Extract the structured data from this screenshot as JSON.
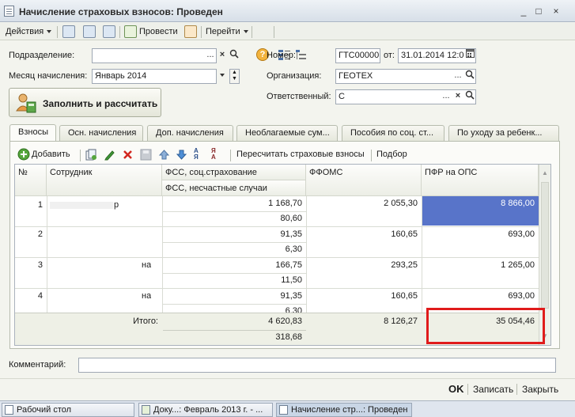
{
  "window": {
    "title": "Начисление страховых взносов: Проведен",
    "controls": [
      "_",
      "□",
      "×"
    ]
  },
  "toolbar": {
    "actions_label": "Действия",
    "post_label": "Провести",
    "goto_label": "Перейти",
    "help_label": "?"
  },
  "form": {
    "subdivision_label": "Подразделение:",
    "subdivision_value": "",
    "month_label": "Месяц начисления:",
    "month_value": "Январь 2014",
    "number_label": "Номер:",
    "number_value": "ГТС00000",
    "from_label": "от:",
    "date_value": "31.01.2014 12:0",
    "org_label": "Организация:",
    "org_value": "ГЕОТЕХ",
    "responsible_label": "Ответственный:",
    "responsible_value": "С",
    "fill_button": "Заполнить и рассчитать"
  },
  "tabs": [
    "Взносы",
    "Осн. начисления",
    "Доп. начисления",
    "Необлагаемые сум...",
    "Пособия по соц. ст...",
    "По уходу за ребенк..."
  ],
  "panel_toolbar": {
    "add_label": "Добавить",
    "recalc_label": "Пересчитать страховые взносы",
    "select_label": "Подбор"
  },
  "grid": {
    "headers": {
      "num": "№",
      "employee": "Сотрудник",
      "fss": "ФСС, соц.страхование",
      "fss_acc": "ФСС, несчастные случаи",
      "ffoms": "ФФОМС",
      "pfr": "ПФР на ОПС"
    },
    "rows": [
      {
        "n": "1",
        "name": "р",
        "fss": "1 168,70",
        "fss_acc": "80,60",
        "ffoms": "2 055,30",
        "pfr": "8 866,00"
      },
      {
        "n": "2",
        "name": "",
        "fss": "91,35",
        "fss_acc": "6,30",
        "ffoms": "160,65",
        "pfr": "693,00"
      },
      {
        "n": "3",
        "name": "на",
        "fss": "166,75",
        "fss_acc": "11,50",
        "ffoms": "293,25",
        "pfr": "1 265,00"
      },
      {
        "n": "4",
        "name": "на",
        "fss": "91,35",
        "fss_acc": "6,30",
        "ffoms": "160,65",
        "pfr": "693,00"
      }
    ],
    "total_label": "Итого:",
    "totals": {
      "fss": "4 620,83",
      "fss_acc": "318,68",
      "ffoms": "8 126,27",
      "pfr": "35 054,46"
    }
  },
  "comment": {
    "label": "Комментарий:",
    "value": ""
  },
  "buttons": {
    "ok": "OK",
    "save": "Записать",
    "close": "Закрыть"
  },
  "taskbar": {
    "desktop": "Рабочий стол",
    "doc1": "Доку...: Февраль 2013 г. - ...",
    "doc2": "Начисление стр...: Проведен"
  },
  "colors": {
    "selected_cell": "#5874c9",
    "highlight_box": "#e01b1b"
  }
}
